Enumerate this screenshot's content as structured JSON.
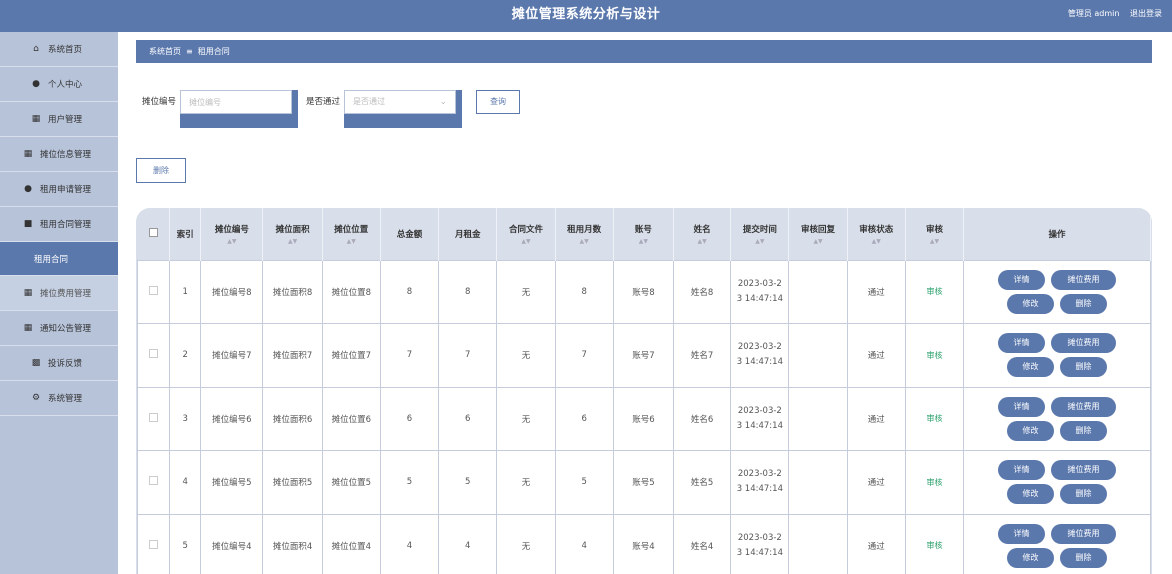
{
  "header": {
    "title": "摊位管理系统分析与设计",
    "user": "管理员 admin",
    "logout": "退出登录"
  },
  "sidebar": {
    "items": [
      {
        "label": "系统首页",
        "icon": "home-icon"
      },
      {
        "label": "个人中心",
        "icon": "person-icon"
      },
      {
        "label": "用户管理",
        "icon": "grid-icon"
      },
      {
        "label": "摊位信息管理",
        "icon": "grid-icon"
      },
      {
        "label": "租用申请管理",
        "icon": "person-icon"
      },
      {
        "label": "租用合同管理",
        "icon": "chat-icon"
      },
      {
        "label": "租用合同",
        "icon": ""
      },
      {
        "label": "摊位费用管理",
        "icon": "grid-icon"
      },
      {
        "label": "通知公告管理",
        "icon": "grid-icon"
      },
      {
        "label": "投诉反馈",
        "icon": "chart-icon"
      },
      {
        "label": "系统管理",
        "icon": "tool-icon"
      }
    ]
  },
  "breadcrumb": {
    "home": "系统首页",
    "current": "租用合同"
  },
  "search": {
    "stall_label": "摊位编号",
    "stall_placeholder": "摊位编号",
    "pass_label": "是否通过",
    "pass_placeholder": "是否通过",
    "query_button": "查询"
  },
  "delete_button": "删除",
  "table": {
    "headers": [
      "索引",
      "摊位编号",
      "摊位面积",
      "摊位位置",
      "总金额",
      "月租金",
      "合同文件",
      "租用月数",
      "账号",
      "姓名",
      "提交时间",
      "审核回复",
      "审核状态",
      "审核",
      "操作"
    ],
    "rows": [
      {
        "idx": "1",
        "code": "摊位编号8",
        "area": "摊位面积8",
        "pos": "摊位位置8",
        "total": "8",
        "rent": "8",
        "file": "无",
        "months": "8",
        "account": "账号8",
        "name": "姓名8",
        "time1": "2023-03-2",
        "time2": "3 14:47:14",
        "reply": "",
        "status": "通过",
        "audit": "审核"
      },
      {
        "idx": "2",
        "code": "摊位编号7",
        "area": "摊位面积7",
        "pos": "摊位位置7",
        "total": "7",
        "rent": "7",
        "file": "无",
        "months": "7",
        "account": "账号7",
        "name": "姓名7",
        "time1": "2023-03-2",
        "time2": "3 14:47:14",
        "reply": "",
        "status": "通过",
        "audit": "审核"
      },
      {
        "idx": "3",
        "code": "摊位编号6",
        "area": "摊位面积6",
        "pos": "摊位位置6",
        "total": "6",
        "rent": "6",
        "file": "无",
        "months": "6",
        "account": "账号6",
        "name": "姓名6",
        "time1": "2023-03-2",
        "time2": "3 14:47:14",
        "reply": "",
        "status": "通过",
        "audit": "审核"
      },
      {
        "idx": "4",
        "code": "摊位编号5",
        "area": "摊位面积5",
        "pos": "摊位位置5",
        "total": "5",
        "rent": "5",
        "file": "无",
        "months": "5",
        "account": "账号5",
        "name": "姓名5",
        "time1": "2023-03-2",
        "time2": "3 14:47:14",
        "reply": "",
        "status": "通过",
        "audit": "审核"
      },
      {
        "idx": "5",
        "code": "摊位编号4",
        "area": "摊位面积4",
        "pos": "摊位位置4",
        "total": "4",
        "rent": "4",
        "file": "无",
        "months": "4",
        "account": "账号4",
        "name": "姓名4",
        "time1": "2023-03-2",
        "time2": "3 14:47:14",
        "reply": "",
        "status": "通过",
        "audit": "审核"
      }
    ],
    "actions": {
      "detail": "详情",
      "fee": "摊位费用",
      "edit": "修改",
      "delete": "删除"
    }
  }
}
